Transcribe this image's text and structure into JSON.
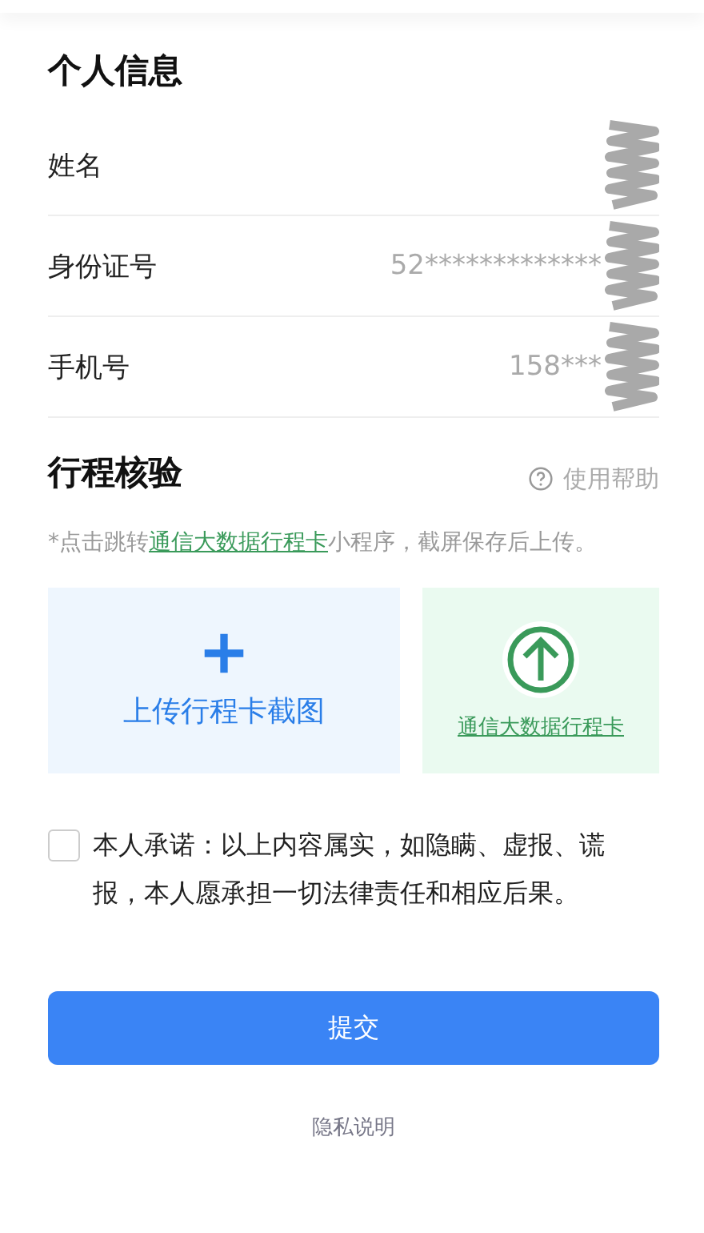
{
  "personal_info": {
    "title": "个人信息",
    "fields": [
      {
        "label": "姓名",
        "redacted": true
      },
      {
        "label": "身份证号",
        "value": "52*************",
        "redacted": true
      },
      {
        "label": "手机号",
        "value": "158***",
        "redacted": true
      }
    ]
  },
  "trip_check": {
    "title": "行程核验",
    "help": "使用帮助",
    "note": {
      "prefix": "*点击跳转",
      "link": "通信大数据行程卡",
      "suffix": "小程序，截屏保存后上传。"
    },
    "upload_tile": {
      "label": "上传行程卡截图"
    },
    "link_tile": {
      "label": "通信大数据行程卡"
    }
  },
  "pledge": {
    "checked": false,
    "text": "本人承诺：以上内容属实，如隐瞒、虚报、谎报，本人愿承担一切法律责任和相应后果。"
  },
  "submit": "提交",
  "privacy": "隐私说明"
}
